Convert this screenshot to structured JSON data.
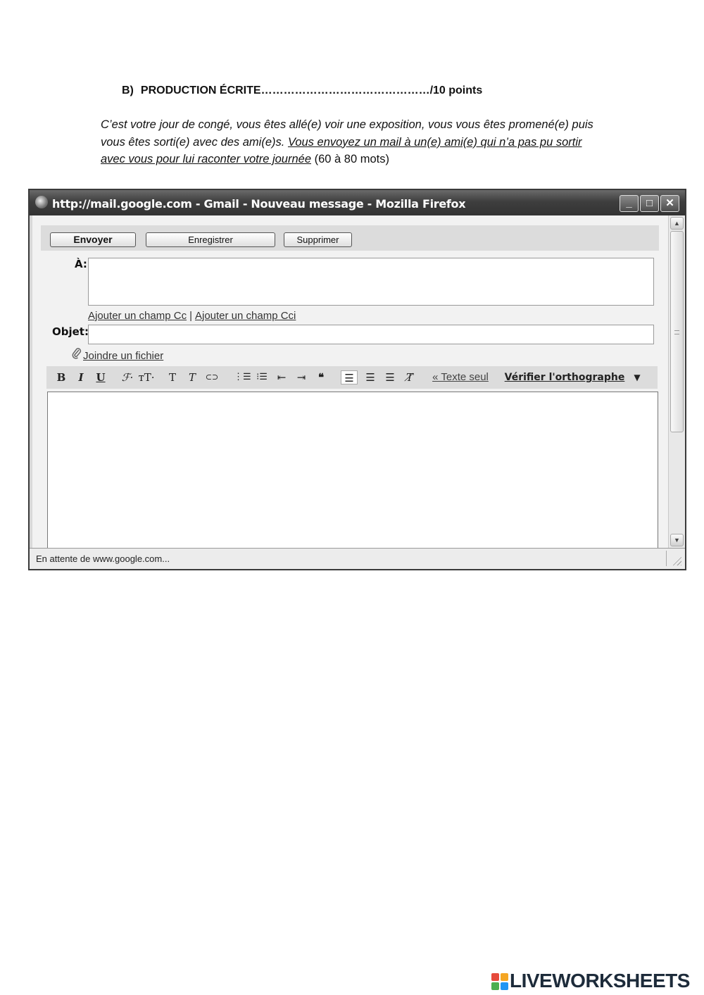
{
  "worksheet": {
    "section_number": "B)",
    "section_title": "PRODUCTION ÉCRITE………………………………………/10 points",
    "prompt_italic": "C’est votre jour de congé, vous êtes allé(e) voir une exposition, vous vous êtes promené(e) puis vous êtes sorti(e) avec des ami(e)s. ",
    "prompt_underlined": "Vous envoyez un mail à un(e) ami(e) qui n’a pas pu sortir avec vous pour lui raconter votre journée",
    "prompt_suffix": " (60 à 80 mots)"
  },
  "window": {
    "title": "http://mail.google.com - Gmail - Nouveau message - Mozilla Firefox",
    "min_label": "_",
    "max_label": "□",
    "close_label": "✕"
  },
  "compose": {
    "send_label": "Envoyer",
    "save_label": "Enregistrer",
    "delete_label": "Supprimer",
    "to_label": "À:",
    "to_value": "",
    "add_cc": "Ajouter un champ Cc",
    "cc_separator": "|",
    "add_bcc": "Ajouter un champ Cci",
    "subject_label": "Objet:",
    "subject_value": "",
    "attach_label": "Joindre un fichier",
    "body_value": ""
  },
  "toolbar": {
    "bold": "B",
    "italic": "I",
    "underline": "U",
    "font": "ℱ·",
    "size": "тT·",
    "text_color": "T",
    "highlight": "T",
    "link": "⊂⊃",
    "numbered_list": "⋮☰",
    "bullet_list": "⁝☰",
    "outdent": "⇤",
    "indent": "⇥",
    "quote": "❝",
    "align_left": "☰",
    "align_center": "☰",
    "align_right": "☰",
    "remove_format": "T̸",
    "plain_text": "« Texte seul",
    "spell_check": "Vérifier l'orthographe",
    "dropdown": "▼"
  },
  "status": {
    "text": "En attente de www.google.com..."
  },
  "branding": {
    "text": "LIVEWORKSHEETS",
    "colors": [
      "#e64a3c",
      "#f5a623",
      "#4caf50",
      "#2196f3"
    ]
  },
  "colors": {
    "titlebar": "#3e3e3e",
    "window_bg": "#f2f2f2"
  }
}
